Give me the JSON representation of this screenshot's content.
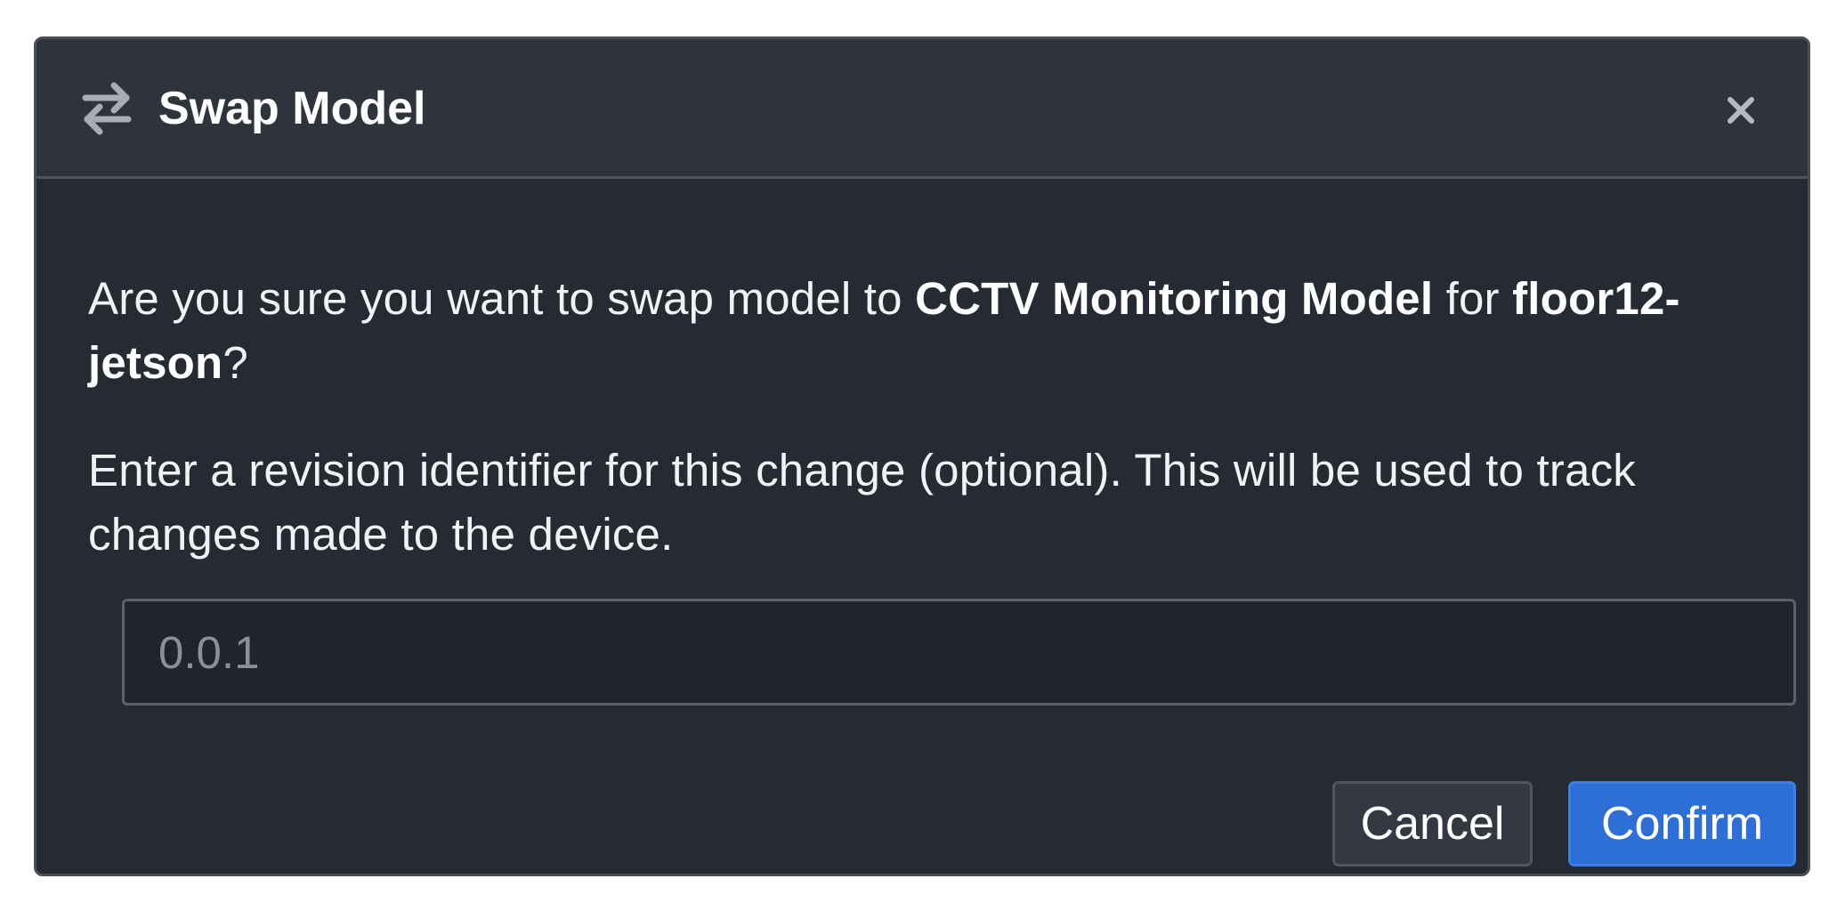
{
  "dialog": {
    "title": "Swap Model",
    "icon": "swap-arrows-icon",
    "close_icon": "close-icon",
    "message": {
      "prefix": "Are you sure you want to swap model to ",
      "model_name": "CCTV Monitoring Model",
      "middle": " for ",
      "device_name": "floor12-jetson",
      "suffix": "?"
    },
    "instructions": "Enter a revision identifier for this change (optional). This will be used to track changes made to the device.",
    "revision_input": {
      "value": "",
      "placeholder": "0.0.1"
    },
    "buttons": {
      "cancel_label": "Cancel",
      "confirm_label": "Confirm"
    }
  },
  "colors": {
    "background": "#262a32",
    "header": "#2f333b",
    "accent": "#2d6fd6",
    "text": "#f1f2f4"
  }
}
